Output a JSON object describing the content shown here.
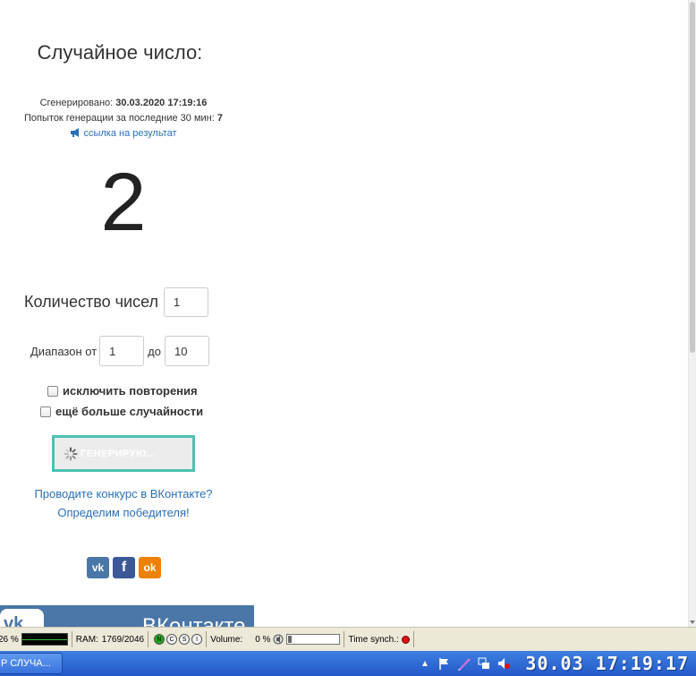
{
  "page": {
    "title": "Случайное число:",
    "generated_label": "Сгенерировано:",
    "generated_value": "30.03.2020 17:19:16",
    "attempts_label": "Попыток генерации за последние 30 мин:",
    "attempts_value": "7",
    "result_link": "ссылка на результат",
    "result_number": "2",
    "count_label": "Количество чисел",
    "count_value": "1",
    "range_from_label": "Диапазон от",
    "range_from_value": "1",
    "range_to_label": "до",
    "range_to_value": "10",
    "exclude_repeats_label": "исключить повторения",
    "more_random_label": "ещё больше случайности",
    "generate_button_label": "ГЕНЕРИРУЮ...",
    "vk_contest_line1": "Проводите конкурс в ВКонтакте?",
    "vk_contest_line2": "Определим победителя!",
    "share": {
      "vk": "vk",
      "fb": "f",
      "ok": "ok"
    },
    "vk_banner_logo": "vk",
    "vk_banner_text": "ВКонтакте"
  },
  "statusbar": {
    "cpu_percent": "26 %",
    "ram_label": "RAM:",
    "ram_value": "1769/2046",
    "flags": [
      "N",
      "C",
      "S",
      "I"
    ],
    "volume_label": "Volume:",
    "volume_value": "0 %",
    "time_synch_label": "Time synch.:"
  },
  "taskbar": {
    "task_button": "P СЛУЧА...",
    "clock": "30.03 17:19:17"
  },
  "colors": {
    "link": "#2a6fb7",
    "button_border": "#4cc2b1",
    "vk_blue": "#4a76a8",
    "fb_blue": "#3b5998",
    "ok_orange": "#ee8208",
    "taskbar": "#2458c9"
  }
}
